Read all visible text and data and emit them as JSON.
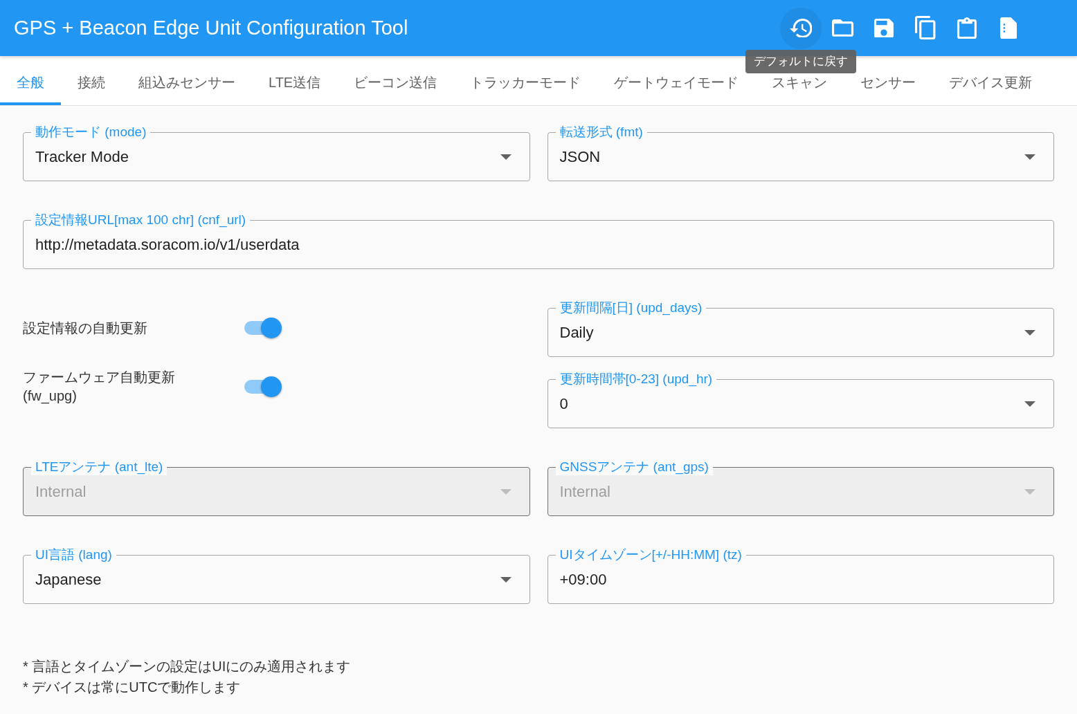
{
  "app_bar": {
    "title": "GPS + Beacon Edge Unit Configuration Tool",
    "actions": [
      {
        "kind": "history",
        "hovered": true,
        "tooltip": "デフォルトに戻す"
      },
      {
        "kind": "folder",
        "hovered": false
      },
      {
        "kind": "save",
        "hovered": false
      },
      {
        "kind": "copy",
        "hovered": false
      },
      {
        "kind": "clipboard",
        "hovered": false
      },
      {
        "kind": "document",
        "hovered": false
      }
    ]
  },
  "tabs": [
    {
      "label": "全般",
      "selected": true
    },
    {
      "label": "接続",
      "selected": false
    },
    {
      "label": "組込みセンサー",
      "selected": false
    },
    {
      "label": "LTE送信",
      "selected": false
    },
    {
      "label": "ビーコン送信",
      "selected": false
    },
    {
      "label": "トラッカーモード",
      "selected": false
    },
    {
      "label": "ゲートウェイモード",
      "selected": false
    },
    {
      "label": "スキャン",
      "selected": false
    },
    {
      "label": "センサー",
      "selected": false
    },
    {
      "label": "デバイス更新",
      "selected": false
    }
  ],
  "form": {
    "rows": [
      {
        "columns": [
          [
            {
              "kind": "select",
              "label": "動作モード (mode)",
              "value": "Tracker Mode",
              "disabled": false
            }
          ],
          [
            {
              "kind": "select",
              "label": "転送形式 (fmt)",
              "value": "JSON",
              "disabled": false
            }
          ]
        ]
      },
      {
        "columns": [
          [
            {
              "kind": "text",
              "label": "設定情報URL[max 100 chr] (cnf_url)",
              "value": "http://metadata.soracom.io/v1/userdata",
              "disabled": false
            }
          ]
        ]
      },
      {
        "columns": [
          [
            {
              "kind": "switch",
              "label": "設定情報の自動更新",
              "on": true
            },
            {
              "kind": "switch",
              "label": "ファームウェア自動更新 (fw_upg)",
              "on": true
            }
          ],
          [
            {
              "kind": "select",
              "label": "更新間隔[日] (upd_days)",
              "value": "Daily",
              "disabled": false
            },
            {
              "kind": "select",
              "label": "更新時間帯[0-23] (upd_hr)",
              "value": "0",
              "disabled": false
            }
          ]
        ]
      },
      {
        "columns": [
          [
            {
              "kind": "select",
              "label": "LTEアンテナ (ant_lte)",
              "value": "Internal",
              "disabled": true
            }
          ],
          [
            {
              "kind": "select",
              "label": "GNSSアンテナ (ant_gps)",
              "value": "Internal",
              "disabled": true
            }
          ]
        ]
      },
      {
        "columns": [
          [
            {
              "kind": "select",
              "label": "UI言語 (lang)",
              "value": "Japanese",
              "disabled": false
            }
          ],
          [
            {
              "kind": "text",
              "label": "UIタイムゾーン[+/-HH:MM] (tz)",
              "value": "+09:00",
              "disabled": false
            }
          ]
        ]
      }
    ]
  },
  "notes": [
    "* 言語とタイムゾーンの設定はUIにのみ適用されます",
    "* デバイスは常にUTCで動作します"
  ]
}
